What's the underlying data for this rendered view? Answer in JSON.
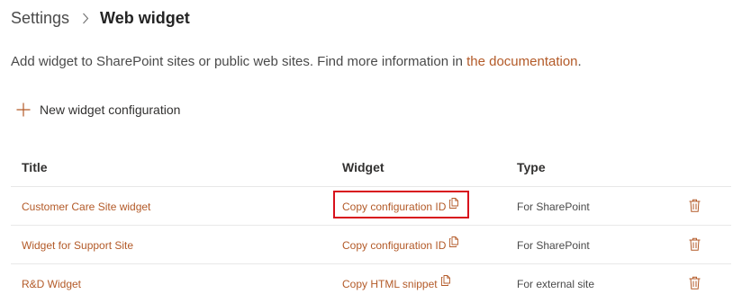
{
  "breadcrumb": {
    "root": "Settings",
    "current": "Web widget"
  },
  "description": {
    "text": "Add widget to SharePoint sites or public web sites. Find more information in ",
    "link": "the documentation",
    "suffix": "."
  },
  "toolbar": {
    "new_label": "New widget configuration"
  },
  "table": {
    "columns": [
      "Title",
      "Widget",
      "Type"
    ],
    "rows": [
      {
        "title": "Customer Care Site widget",
        "widget": "Copy configuration ID",
        "type": "For SharePoint",
        "highlighted": true
      },
      {
        "title": "Widget for Support Site",
        "widget": "Copy configuration ID",
        "type": "For SharePoint",
        "highlighted": false
      },
      {
        "title": "R&D Widget",
        "widget": "Copy HTML snippet",
        "type": "For external site",
        "highlighted": false
      }
    ]
  },
  "icons": {
    "separator": "chevron-right-icon",
    "new": "plus-icon",
    "copy": "copy-icon",
    "delete": "trash-icon"
  },
  "colors": {
    "accent": "#b35a28",
    "highlight_border": "#d8101c",
    "text": "#323130",
    "muted": "#4a4a4a"
  }
}
